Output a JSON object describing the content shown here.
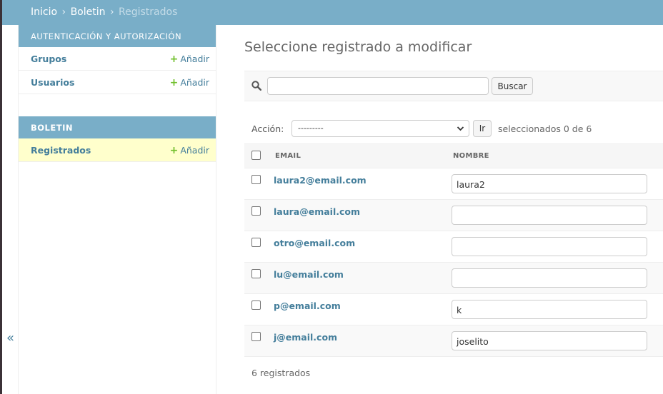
{
  "breadcrumbs": {
    "items": [
      "Inicio",
      "Boletin",
      "Registrados"
    ],
    "separator": "›"
  },
  "sidebar": {
    "modules": [
      {
        "caption": "AUTENTICACIÓN Y AUTORIZACIÓN",
        "models": [
          {
            "label": "Grupos",
            "add": "Añadir"
          },
          {
            "label": "Usuarios",
            "add": "Añadir"
          }
        ]
      },
      {
        "caption": "BOLETIN",
        "models": [
          {
            "label": "Registrados",
            "add": "Añadir",
            "current": true
          }
        ]
      }
    ],
    "collapse_toggle": "«"
  },
  "main": {
    "title": "Seleccione registrado a modificar",
    "search": {
      "value": "",
      "button": "Buscar",
      "icon": "search-icon"
    },
    "actions": {
      "label": "Acción:",
      "selected": "---------",
      "go": "Ir",
      "counter": "seleccionados 0 de 6"
    },
    "table": {
      "columns": [
        "EMAIL",
        "NOMBRE"
      ],
      "rows": [
        {
          "email": "laura2@email.com",
          "nombre": "laura2"
        },
        {
          "email": "laura@email.com",
          "nombre": ""
        },
        {
          "email": "otro@email.com",
          "nombre": ""
        },
        {
          "email": "lu@email.com",
          "nombre": ""
        },
        {
          "email": "p@email.com",
          "nombre": "k"
        },
        {
          "email": "j@email.com",
          "nombre": "joselito"
        }
      ]
    },
    "paginator": "6 registrados"
  },
  "colors": {
    "header": "#79aec8",
    "link": "#447e9b",
    "add": "#70bf2b",
    "current_row": "#ffffcc"
  }
}
